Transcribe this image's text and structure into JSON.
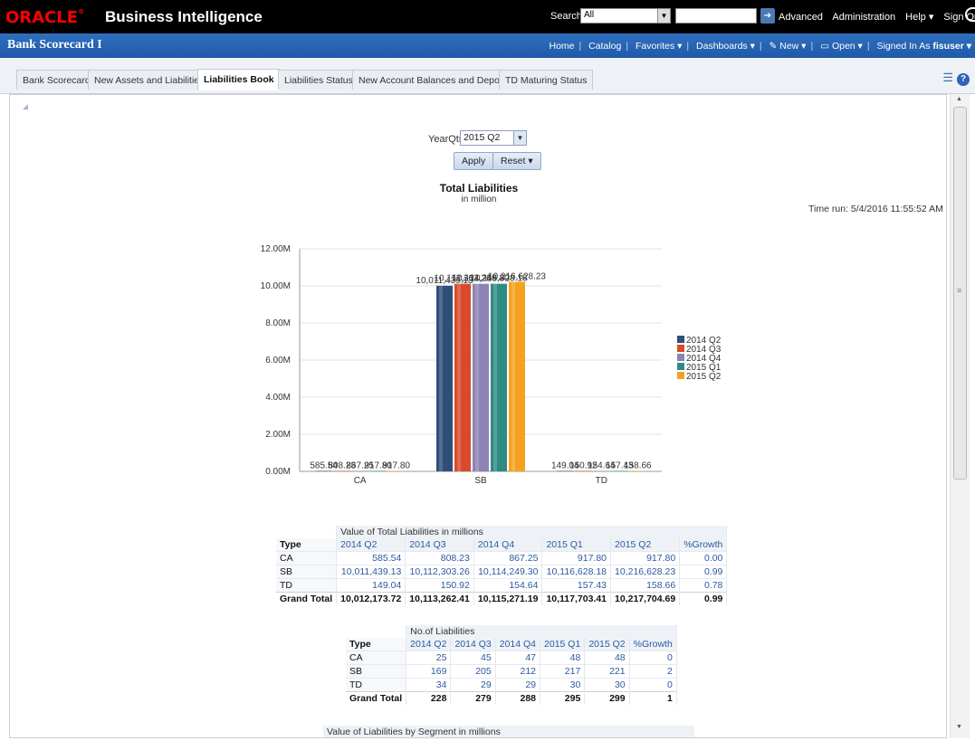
{
  "header": {
    "logo": "ORACLE",
    "product": "Business Intelligence",
    "search_label": "Search",
    "search_scope": "All",
    "links": [
      "Advanced",
      "Administration",
      "Help ▾",
      "Sign Out"
    ]
  },
  "subheader": {
    "dashboard_title": "Bank Scorecard I",
    "links": [
      "Home",
      "Catalog",
      "Favorites ▾",
      "Dashboards ▾",
      "New ▾",
      "Open ▾"
    ],
    "signed_in_label": "Signed In As",
    "user": "fisuser ▾"
  },
  "tabs": [
    {
      "label": "Bank Scorecard"
    },
    {
      "label": "New Assets and Liabilities"
    },
    {
      "label": "Liabilities Book",
      "active": true
    },
    {
      "label": "Liabilities Status"
    },
    {
      "label": "New Account Balances and Deposits"
    },
    {
      "label": "TD Maturing Status"
    }
  ],
  "prompt": {
    "label": "YearQtr",
    "value": "2015 Q2",
    "apply": "Apply",
    "reset": "Reset ▾"
  },
  "time_run": "Time run: 5/4/2016 11:55:52 AM",
  "chart_data": {
    "type": "bar",
    "title": "Total Liabilities",
    "subtitle": "in million",
    "categories": [
      "CA",
      "SB",
      "TD"
    ],
    "ylim": [
      0,
      12000000
    ],
    "yticks": [
      "0.00M",
      "2.00M",
      "4.00M",
      "6.00M",
      "8.00M",
      "10.00M",
      "12.00M"
    ],
    "legend_position": "right",
    "series": [
      {
        "name": "2014 Q2",
        "color": "#2e4f78",
        "values": [
          585.54,
          10011439.13,
          149.04
        ],
        "labels": [
          "585.54",
          "10,011,439.13",
          "149.04"
        ]
      },
      {
        "name": "2014 Q3",
        "color": "#d94a2c",
        "values": [
          808.23,
          10112303.26,
          150.92
        ],
        "labels": [
          "808.23",
          "10,112,303.26",
          "150.92"
        ]
      },
      {
        "name": "2014 Q4",
        "color": "#8c84b6",
        "values": [
          867.25,
          10114249.3,
          154.64
        ],
        "labels": [
          "867.25",
          "10,114,249.30",
          "154.64"
        ]
      },
      {
        "name": "2015 Q1",
        "color": "#2f8a84",
        "values": [
          917.8,
          10116628.18,
          157.43
        ],
        "labels": [
          "917.80",
          "10,116,628.18",
          "157.43"
        ]
      },
      {
        "name": "2015 Q2",
        "color": "#f4a21e",
        "values": [
          917.8,
          10216628.23,
          158.66
        ],
        "labels": [
          "917.80",
          "10,216,628.23",
          "158.66"
        ]
      }
    ]
  },
  "table1": {
    "title": "Value of Total Liabilities in millions",
    "headers": [
      "Type",
      "2014 Q2",
      "2014 Q3",
      "2014 Q4",
      "2015 Q1",
      "2015 Q2",
      "%Growth"
    ],
    "rows": [
      [
        "CA",
        "585.54",
        "808.23",
        "867.25",
        "917.80",
        "917.80",
        "0.00"
      ],
      [
        "SB",
        "10,011,439.13",
        "10,112,303.26",
        "10,114,249.30",
        "10,116,628.18",
        "10,216,628.23",
        "0.99"
      ],
      [
        "TD",
        "149.04",
        "150.92",
        "154.64",
        "157.43",
        "158.66",
        "0.78"
      ]
    ],
    "total": [
      "Grand Total",
      "10,012,173.72",
      "10,113,262.41",
      "10,115,271.19",
      "10,117,703.41",
      "10,217,704.69",
      "0.99"
    ]
  },
  "table2": {
    "title": "No.of Liabilities",
    "headers": [
      "Type",
      "2014 Q2",
      "2014 Q3",
      "2014 Q4",
      "2015 Q1",
      "2015 Q2",
      "%Growth"
    ],
    "rows": [
      [
        "CA",
        "25",
        "45",
        "47",
        "48",
        "48",
        "0"
      ],
      [
        "SB",
        "169",
        "205",
        "212",
        "217",
        "221",
        "2"
      ],
      [
        "TD",
        "34",
        "29",
        "29",
        "30",
        "30",
        "0"
      ]
    ],
    "total": [
      "Grand Total",
      "228",
      "279",
      "288",
      "295",
      "299",
      "1"
    ]
  },
  "table3": {
    "title": "Value of Liabilities by Segment in millions"
  }
}
